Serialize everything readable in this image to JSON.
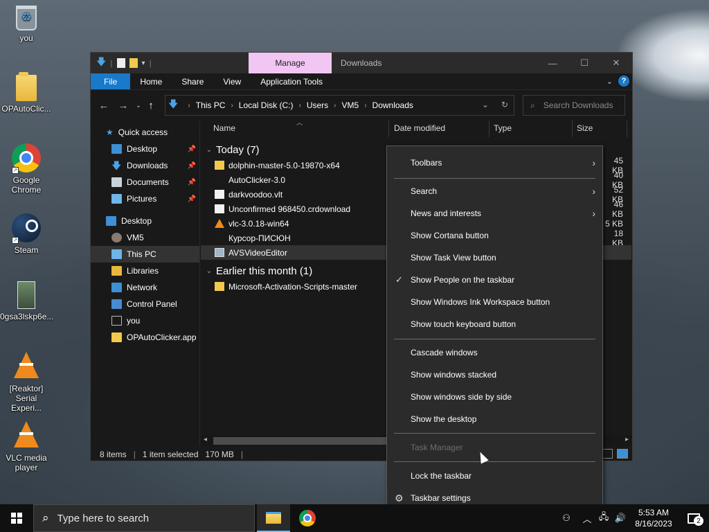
{
  "desktop": {
    "icons": [
      {
        "label": "you",
        "icon": "recycle-bin-icon"
      },
      {
        "label": "OPAutoClic...",
        "icon": "folder-icon"
      },
      {
        "label": "Google Chrome",
        "icon": "chrome-icon"
      },
      {
        "label": "Steam",
        "icon": "steam-icon"
      },
      {
        "label": "0gsa3lskp6e...",
        "icon": "image-file-icon"
      },
      {
        "label": "[Reaktor] Serial Experi...",
        "icon": "vlc-icon"
      },
      {
        "label": "VLC media player",
        "icon": "vlc-icon"
      }
    ]
  },
  "explorer": {
    "ribbon_context_tab": "Manage",
    "window_title": "Downloads",
    "ribbon_tabs": [
      "File",
      "Home",
      "Share",
      "View",
      "Application Tools"
    ],
    "breadcrumb": [
      "This PC",
      "Local Disk (C:)",
      "Users",
      "VM5",
      "Downloads"
    ],
    "search_placeholder": "Search Downloads",
    "nav": [
      {
        "label": "Quick access",
        "icon": "star-icon",
        "level": 0
      },
      {
        "label": "Desktop",
        "icon": "desktop-icon",
        "level": 1,
        "pinned": true
      },
      {
        "label": "Downloads",
        "icon": "download-icon",
        "level": 1,
        "pinned": true
      },
      {
        "label": "Documents",
        "icon": "documents-icon",
        "level": 1,
        "pinned": true
      },
      {
        "label": "Pictures",
        "icon": "pictures-icon",
        "level": 1,
        "pinned": true
      },
      {
        "label": "Desktop",
        "icon": "desktop-icon",
        "level": 0
      },
      {
        "label": "VM5",
        "icon": "user-icon",
        "level": 1
      },
      {
        "label": "This PC",
        "icon": "computer-icon",
        "level": 1,
        "selected": true
      },
      {
        "label": "Libraries",
        "icon": "library-icon",
        "level": 1
      },
      {
        "label": "Network",
        "icon": "network-icon",
        "level": 1
      },
      {
        "label": "Control Panel",
        "icon": "control-panel-icon",
        "level": 1
      },
      {
        "label": "you",
        "icon": "recycle-bin-icon",
        "level": 1
      },
      {
        "label": "OPAutoClicker.app",
        "icon": "folder-icon",
        "level": 1
      }
    ],
    "columns": [
      "Name",
      "Date modified",
      "Type",
      "Size"
    ],
    "groups": [
      {
        "label": "Today (7)",
        "files": [
          {
            "name": "dolphin-master-5.0-19870-x64",
            "icon": "folder-icon",
            "size": "45 KB"
          },
          {
            "name": "AutoClicker-3.0",
            "icon": "app-icon",
            "size": "40 KB"
          },
          {
            "name": "darkvoodoo.vlt",
            "icon": "file-icon",
            "size": "52 KB"
          },
          {
            "name": "Unconfirmed 968450.crdownload",
            "icon": "file-icon",
            "size": "46 KB"
          },
          {
            "name": "vlc-3.0.18-win64",
            "icon": "vlc-icon",
            "size": "5 KB"
          },
          {
            "name": "Курсор-ПИСЮН",
            "icon": "archive-icon",
            "size": "18 KB"
          },
          {
            "name": "AVSVideoEditor",
            "icon": "installer-icon",
            "size": "",
            "selected": true
          }
        ]
      },
      {
        "label": "Earlier this month (1)",
        "files": [
          {
            "name": "Microsoft-Activation-Scripts-master",
            "icon": "folder-icon",
            "size": ""
          }
        ]
      }
    ],
    "status": {
      "items": "8 items",
      "selected": "1 item selected",
      "size": "170 MB"
    }
  },
  "context_menu": {
    "items": [
      {
        "label": "Toolbars",
        "submenu": true,
        "y": 0
      },
      {
        "label": "Search",
        "submenu": true
      },
      {
        "label": "News and interests",
        "submenu": true
      },
      {
        "label": "Show Cortana button"
      },
      {
        "label": "Show Task View button"
      },
      {
        "label": "Show People on the taskbar",
        "checked": true
      },
      {
        "label": "Show Windows Ink Workspace button"
      },
      {
        "label": "Show touch keyboard button"
      },
      {
        "label": "Cascade windows"
      },
      {
        "label": "Show windows stacked"
      },
      {
        "label": "Show windows side by side"
      },
      {
        "label": "Show the desktop"
      },
      {
        "label": "Task Manager",
        "disabled": true
      },
      {
        "label": "Lock the taskbar"
      },
      {
        "label": "Taskbar settings",
        "icon": "gear-icon"
      }
    ]
  },
  "taskbar": {
    "search_placeholder": "Type here to search",
    "time": "5:53 AM",
    "date": "8/16/2023",
    "notification_count": "2"
  }
}
